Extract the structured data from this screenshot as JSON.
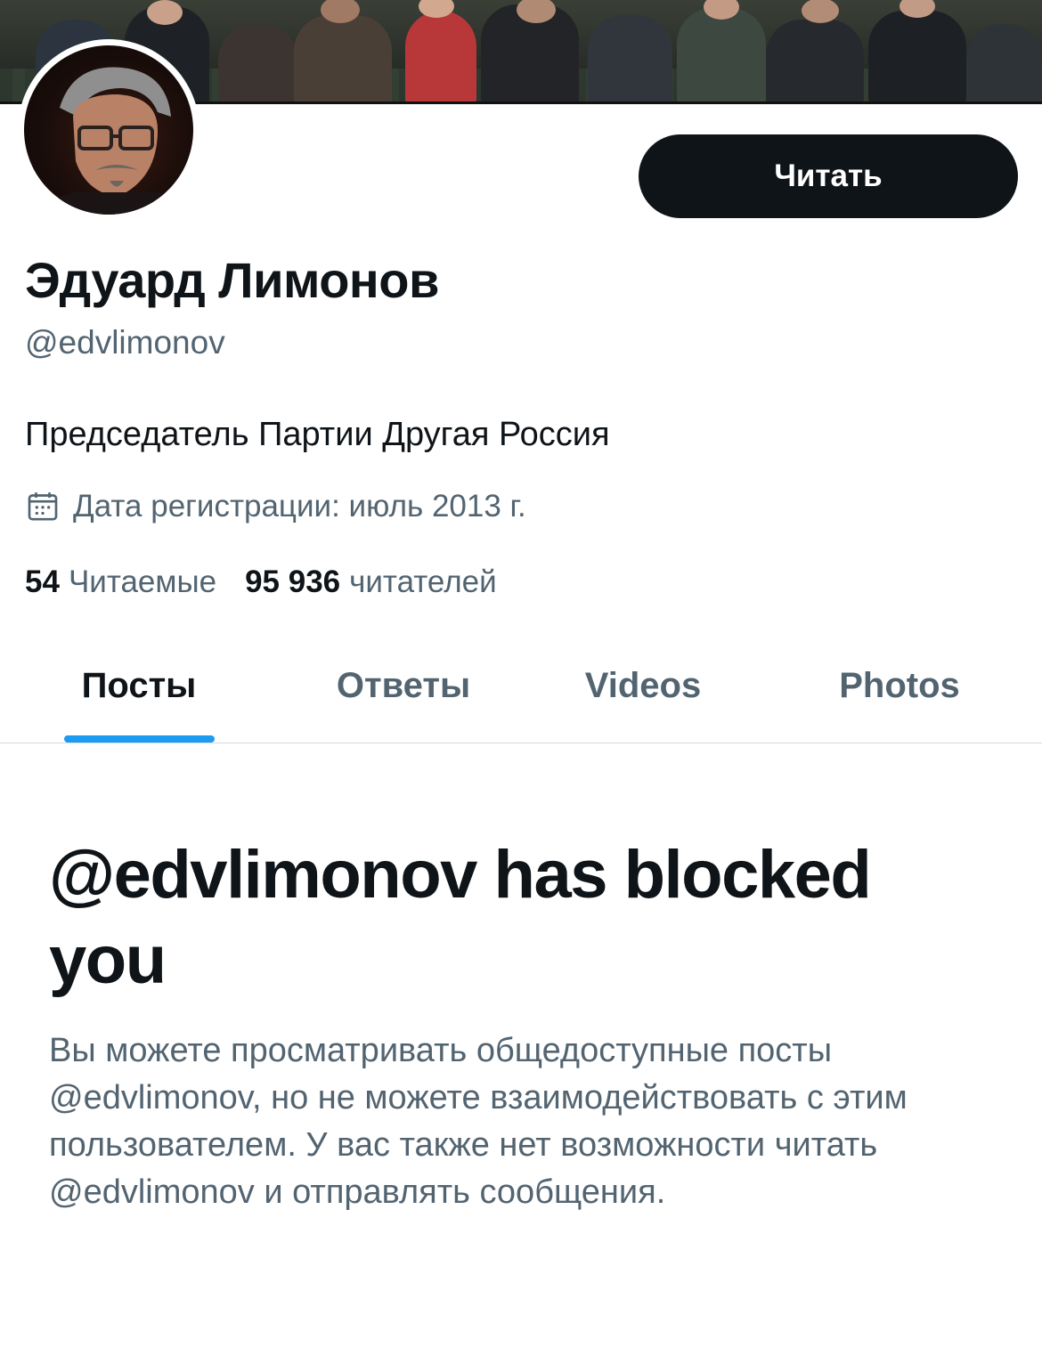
{
  "profile": {
    "follow_label": "Читать",
    "display_name": "Эдуард Лимонов",
    "handle": "@edvlimonov",
    "bio": "Председатель Партии Другая Россия",
    "joined": "Дата регистрации: июль 2013 г.",
    "following_count": "54",
    "following_label": "Читаемые",
    "followers_count": "95 936",
    "followers_label": "читателей"
  },
  "tabs": [
    {
      "label": "Посты",
      "active": true
    },
    {
      "label": "Ответы",
      "active": false
    },
    {
      "label": "Videos",
      "active": false
    },
    {
      "label": "Photos",
      "active": false
    }
  ],
  "blocked": {
    "title": "@edvlimonov has blocked you",
    "body": "Вы можете просматривать общедоступные посты @edvlimonov, но не можете взаимодействовать с этим пользователем. У вас также нет возможности читать @edvlimonov и отправлять сообщения."
  },
  "colors": {
    "accent": "#1d9bf0",
    "text_primary": "#0f1419",
    "text_secondary": "#536471"
  },
  "icons": {
    "joined": "calendar-icon"
  }
}
